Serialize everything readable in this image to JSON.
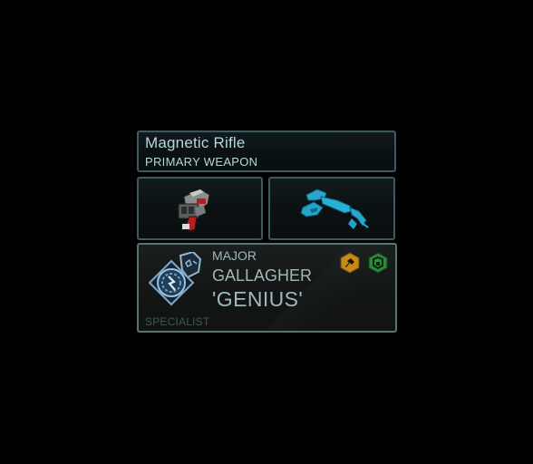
{
  "weapon": {
    "name": "Magnetic Rifle",
    "slot": "PRIMARY WEAPON"
  },
  "items": [
    {
      "icon": "grenade-launcher-icon",
      "color": "#9e9e9e"
    },
    {
      "icon": "arc-thrower-icon",
      "color": "#2fa6c6"
    }
  ],
  "soldier": {
    "rank": "MAJOR",
    "last_name": "GALLAGHER",
    "nickname": "'GENIUS'",
    "class": "SPECIALIST",
    "class_icon": "specialist-class-emblem-icon",
    "ability_badges": [
      {
        "icon": "hacking-ability-icon",
        "color": "#c58a17"
      },
      {
        "icon": "combat-protocol-ability-icon",
        "color": "#2e8a3b"
      }
    ]
  },
  "colors": {
    "text_primary": "#b6d7dc",
    "text_soldier": "#9fb8bd",
    "panel_border": "#3f5a5e",
    "background": "#000000"
  }
}
